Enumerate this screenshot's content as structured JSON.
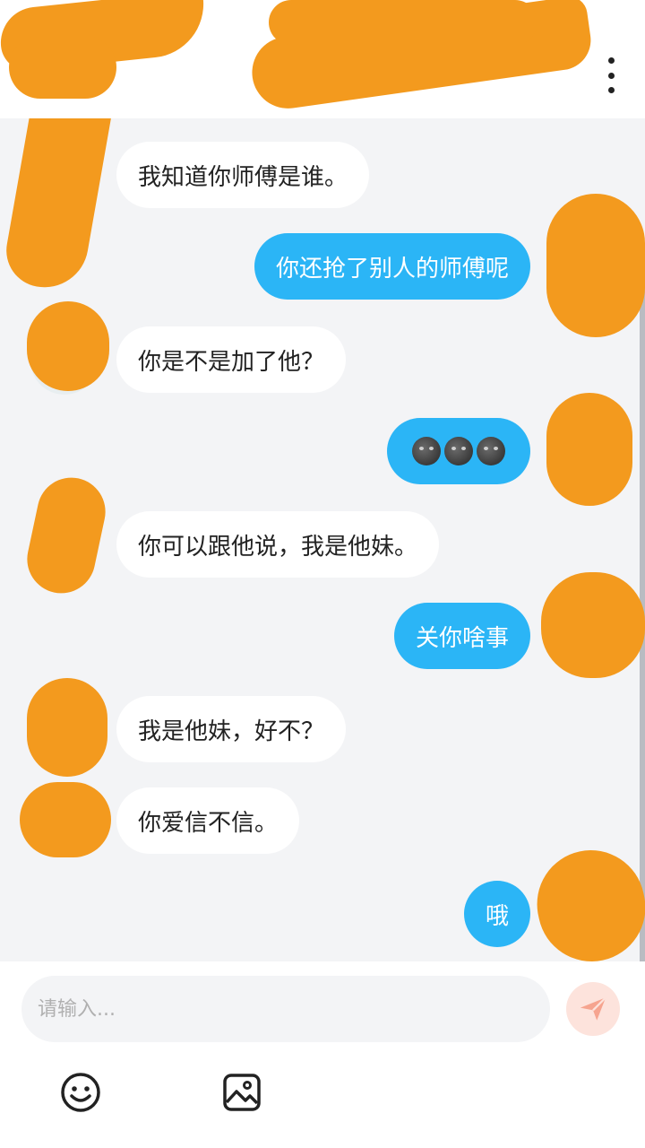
{
  "messages": [
    {
      "side": "in",
      "text": "我知道你师傅是谁。"
    },
    {
      "side": "out",
      "text": "你还抢了别人的师傅呢"
    },
    {
      "side": "in",
      "text": "你是不是加了他？"
    },
    {
      "side": "out",
      "emoji": "new-moon-face-x3"
    },
    {
      "side": "in",
      "text": "你可以跟他说，我是他妹。"
    },
    {
      "side": "out",
      "text": "关你啥事"
    },
    {
      "side": "in",
      "text": "我是他妹，好不？"
    },
    {
      "side": "in",
      "text": "你爱信不信。"
    },
    {
      "side": "out",
      "text": "哦"
    }
  ],
  "composer": {
    "placeholder": "请输入...",
    "send_icon": "send-icon",
    "tools": [
      "emoji-icon",
      "image-icon"
    ]
  },
  "header": {
    "menu_icon": "more-vertical-icon"
  },
  "colors": {
    "outgoing_bubble": "#2bb5f6",
    "incoming_bubble": "#ffffff",
    "chat_background": "#f3f4f6",
    "redaction": "#f39a1e",
    "send_button": "#fde3dc"
  }
}
